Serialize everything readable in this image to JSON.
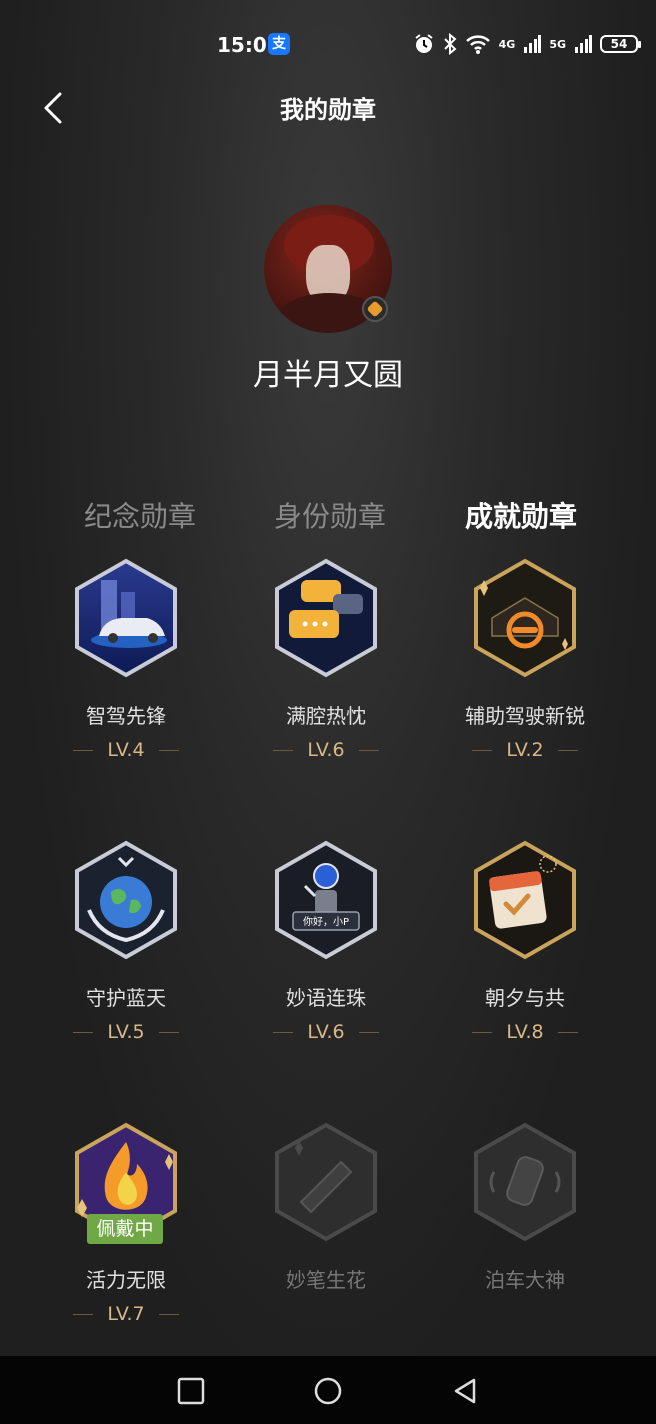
{
  "status_bar": {
    "time": "15:07",
    "alipay_label": "支",
    "network_4g": "4G",
    "network_5g": "5G",
    "battery": "54"
  },
  "header": {
    "title": "我的勋章"
  },
  "profile": {
    "username": "月半月又圆"
  },
  "tabs": [
    {
      "label": "纪念勋章",
      "active": false
    },
    {
      "label": "身份勋章",
      "active": false
    },
    {
      "label": "成就勋章",
      "active": true
    }
  ],
  "badges": [
    {
      "name": "智驾先锋",
      "level": "LV.4",
      "unlocked": true
    },
    {
      "name": "满腔热忱",
      "level": "LV.6",
      "unlocked": true
    },
    {
      "name": "辅助驾驶新锐",
      "level": "LV.2",
      "unlocked": true
    },
    {
      "name": "守护蓝天",
      "level": "LV.5",
      "unlocked": true
    },
    {
      "name": "妙语连珠",
      "level": "LV.6",
      "unlocked": true,
      "icon_text": "你好，小P"
    },
    {
      "name": "朝夕与共",
      "level": "LV.8",
      "unlocked": true
    },
    {
      "name": "活力无限",
      "level": "LV.7",
      "unlocked": true,
      "tag": "佩戴中"
    },
    {
      "name": "妙笔生花",
      "level": "",
      "unlocked": false
    },
    {
      "name": "泊车大神",
      "level": "",
      "unlocked": false
    }
  ],
  "colors": {
    "accent_gold": "#d8b887",
    "wearing_green": "#6fa844"
  },
  "navbar": {
    "icons": [
      "recent-apps-icon",
      "home-icon",
      "back-icon"
    ]
  }
}
